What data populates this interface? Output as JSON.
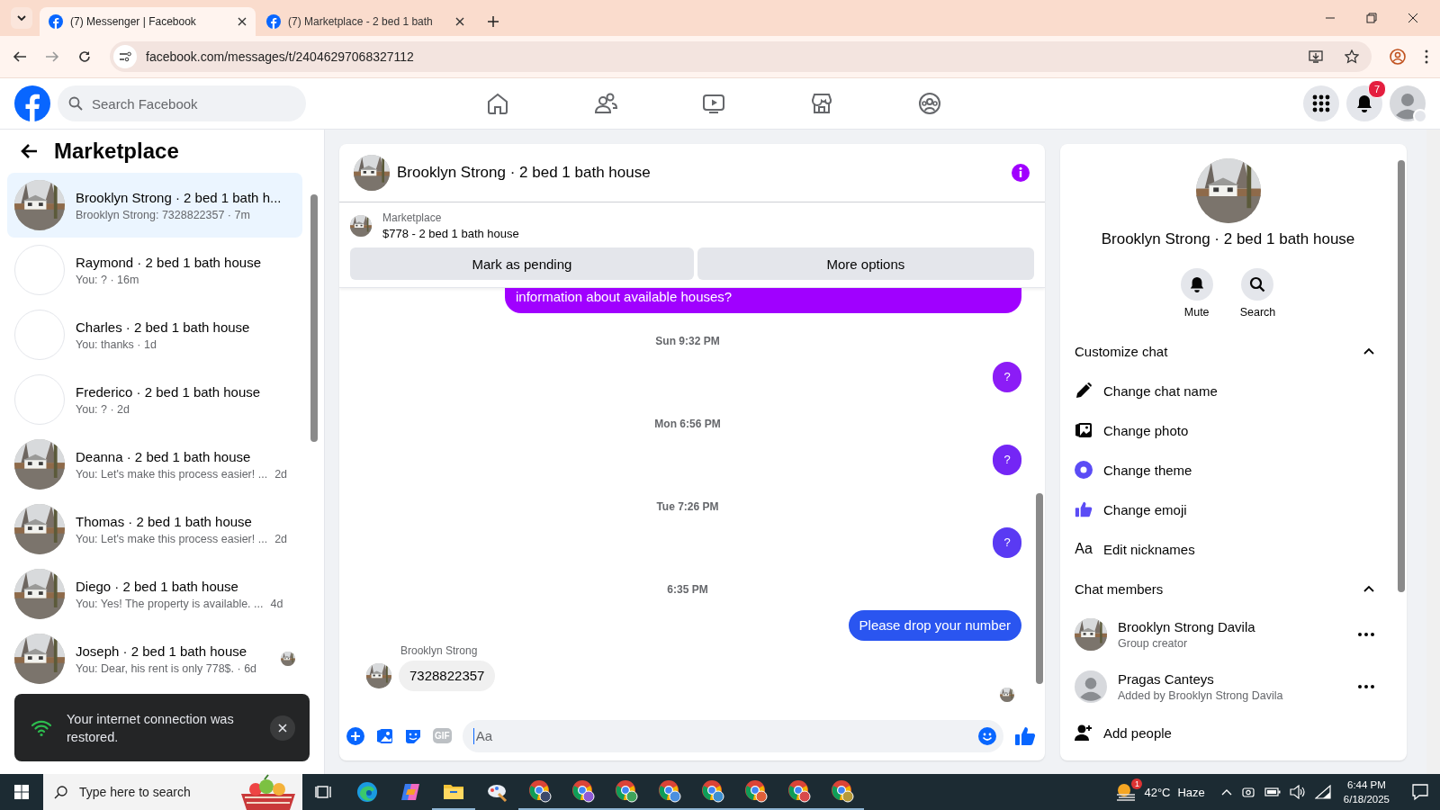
{
  "browser": {
    "tabs": [
      {
        "title": "(7) Messenger | Facebook",
        "selected": true
      },
      {
        "title": "(7) Marketplace - 2 bed 1 bath",
        "selected": false
      }
    ],
    "url": "facebook.com/messages/t/24046297068327112"
  },
  "facebook": {
    "search_placeholder": "Search Facebook",
    "nav": [
      {
        "kind": "home"
      },
      {
        "kind": "friends"
      },
      {
        "kind": "video"
      },
      {
        "kind": "marketplace"
      },
      {
        "kind": "groups"
      }
    ],
    "notification_count": "7"
  },
  "sidebar": {
    "title": "Marketplace",
    "conversations": [
      {
        "name": "Brooklyn Strong · 2 bed 1 bath h...",
        "preview": "Brooklyn Strong: 7328822357 · 7m",
        "has_photo": true,
        "selected": true,
        "seen": false
      },
      {
        "name": "Raymond · 2 bed 1 bath house",
        "preview": "You: ? · 16m",
        "has_photo": false,
        "selected": false,
        "seen": false
      },
      {
        "name": "Charles · 2 bed 1 bath house",
        "preview": "You: thanks · 1d",
        "has_photo": false,
        "selected": false,
        "seen": false
      },
      {
        "name": "Frederico · 2 bed 1 bath house",
        "preview": "You: ? · 2d",
        "has_photo": false,
        "selected": false,
        "seen": false
      },
      {
        "name": "Deanna · 2 bed 1 bath house",
        "preview": "You: Let's make this process easier! ...",
        "time": "2d",
        "has_photo": true,
        "selected": false,
        "seen": false
      },
      {
        "name": "Thomas · 2 bed 1 bath house",
        "preview": "You: Let's make this process easier! ...",
        "time": "2d",
        "has_photo": true,
        "selected": false,
        "seen": false
      },
      {
        "name": "Diego · 2 bed 1 bath house",
        "preview": "You: Yes! The property is available. ...",
        "time": "4d",
        "has_photo": true,
        "selected": false,
        "seen": false
      },
      {
        "name": "Joseph · 2 bed 1 bath house",
        "preview": "You: Dear, his rent is only 778$. · 6d",
        "has_photo": true,
        "selected": false,
        "seen": true
      }
    ]
  },
  "toast": {
    "message": "Your internet connection was restored."
  },
  "chat": {
    "title": "Brooklyn Strong · 2 bed 1 bath house",
    "listing": {
      "label": "Marketplace",
      "item": "$778 - 2 bed 1 bath house"
    },
    "buttons": [
      "Mark as pending",
      "More options"
    ],
    "messages": [
      {
        "kind": "outgoing",
        "text": "information about available houses?",
        "color": "#a000ff"
      },
      {
        "kind": "time",
        "text": "Sun 9:32 PM"
      },
      {
        "kind": "outgoing",
        "text": "?",
        "color": "#8c1cf6"
      },
      {
        "kind": "time",
        "text": "Mon 6:56 PM"
      },
      {
        "kind": "outgoing",
        "text": "?",
        "color": "#7426f5"
      },
      {
        "kind": "time",
        "text": "Tue 7:26 PM"
      },
      {
        "kind": "outgoing",
        "text": "?",
        "color": "#5a3af3"
      },
      {
        "kind": "time",
        "text": "6:35 PM"
      },
      {
        "kind": "outgoing",
        "text": "Please drop your number",
        "color": "#2a55f0"
      },
      {
        "kind": "incoming",
        "sender": "Brooklyn Strong",
        "text": "7328822357"
      }
    ],
    "composer": {
      "gif_label": "GIF",
      "placeholder": "Aa"
    }
  },
  "details": {
    "title": "Brooklyn Strong · 2 bed 1 bath house",
    "actions": [
      {
        "kind": "mute",
        "label": "Mute"
      },
      {
        "kind": "search",
        "label": "Search"
      }
    ],
    "sections": [
      {
        "title": "Customize chat",
        "expanded": true,
        "items": [
          {
            "kind": "pencil",
            "label": "Change chat name"
          },
          {
            "label": "Change photo"
          },
          {
            "kind": "theme",
            "label": "Change theme"
          },
          {
            "kind": "emoji",
            "label": "Change emoji"
          },
          {
            "kind": "nicknames",
            "label": "Edit nicknames",
            "icon_text": "Aa"
          }
        ]
      },
      {
        "title": "Chat members",
        "expanded": true,
        "members": [
          {
            "name": "Brooklyn Strong Davila",
            "role": "Group creator",
            "has_photo": true
          },
          {
            "name": "Pragas Canteys",
            "role": "Added by Brooklyn Strong Davila",
            "has_photo": false
          }
        ],
        "add_label": "Add people"
      }
    ]
  },
  "taskbar": {
    "search_placeholder": "Type here to search",
    "apps": [
      {
        "kind": "taskview",
        "active": false
      },
      {
        "kind": "edge",
        "active": false
      },
      {
        "kind": "copilot",
        "active": false
      },
      {
        "kind": "files",
        "active": true
      },
      {
        "kind": "paint",
        "active": false
      },
      {
        "kind": "chrome",
        "color": "#3b4a6b",
        "active": true
      },
      {
        "kind": "chrome",
        "color": "#8e5bd6",
        "active": true
      },
      {
        "kind": "chrome",
        "color": "#3fa45b",
        "active": true
      },
      {
        "kind": "chrome",
        "color": "#4a8fe0",
        "active": true
      },
      {
        "kind": "chrome",
        "color": "#3d8fd0",
        "active": true
      },
      {
        "kind": "chrome",
        "color": "#e0603a",
        "active": true
      },
      {
        "kind": "chrome",
        "color": "#d94a4a",
        "active": true
      },
      {
        "kind": "chrome",
        "color": "#b59a3a",
        "active": true
      }
    ],
    "weather": {
      "temperature": "42°C",
      "condition": "Haze",
      "badge": "1"
    },
    "time": "6:44 PM",
    "date": "6/18/2025"
  }
}
